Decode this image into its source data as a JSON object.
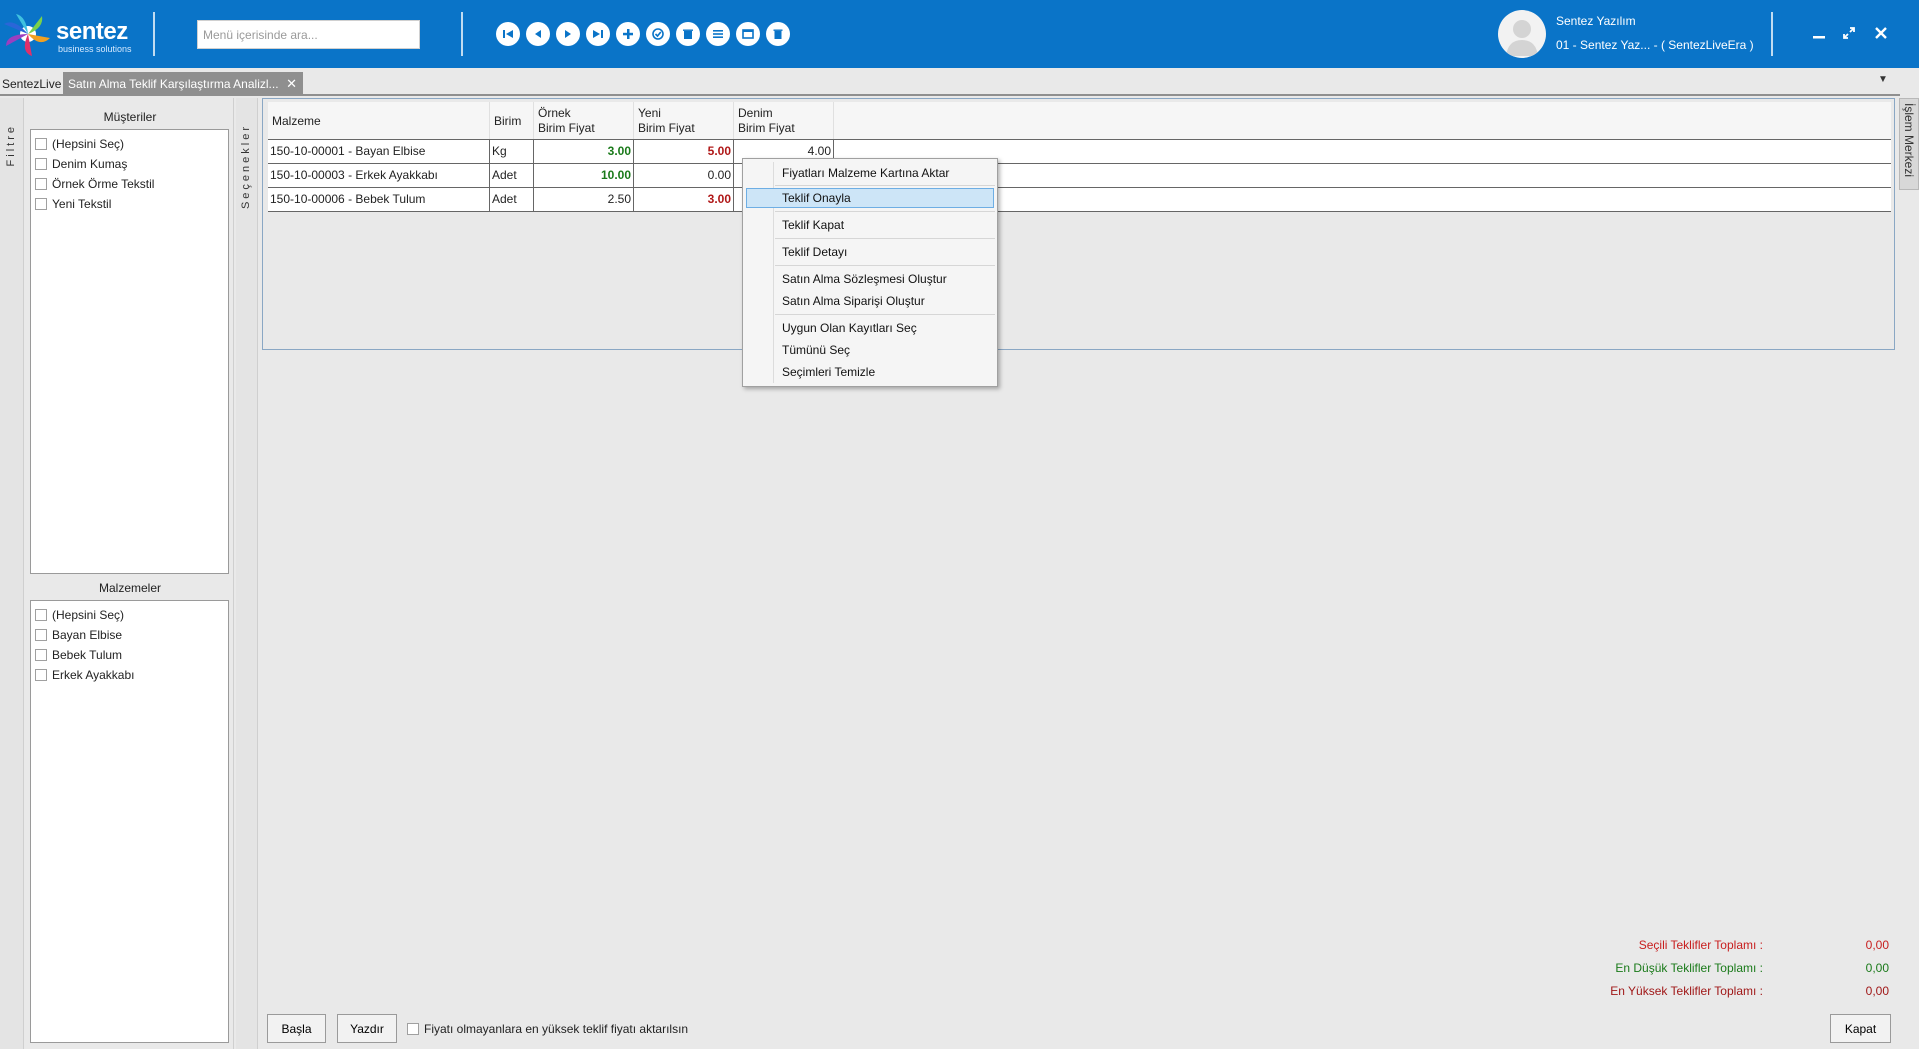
{
  "header": {
    "brand": "sentez",
    "brand_sub": "business solutions",
    "search_placeholder": "Menü içerisinde ara...",
    "user_name": "Sentez Yazılım",
    "company": "01 - Sentez Yaz... - ( SentezLiveEra )",
    "toolbar_icons": [
      "first-icon",
      "previous-icon",
      "next-icon",
      "last-icon",
      "add-icon",
      "approve-icon",
      "delete-icon",
      "list-icon",
      "window-icon",
      "trash-icon"
    ],
    "accent_color": "#0a74c8"
  },
  "tabs": {
    "home": "SentezLive",
    "active": "Satın Alma Teklif Karşılaştırma Analizl...",
    "close": "✕"
  },
  "left": {
    "filter_label": "Filtre",
    "options_label": "Seçenekler",
    "customers_title": "Müşteriler",
    "customers": [
      "(Hepsini Seç)",
      "Denim Kumaş",
      "Örnek Örme Tekstil",
      "Yeni Tekstil"
    ],
    "materials_title": "Malzemeler",
    "materials": [
      "(Hepsini Seç)",
      "Bayan Elbise",
      "Bebek Tulum",
      "Erkek Ayakkabı"
    ]
  },
  "grid": {
    "columns": [
      "Malzeme",
      "Birim",
      "Örnek\nBirim Fiyat",
      "Yeni\nBirim Fiyat",
      "Denim\nBirim Fiyat"
    ],
    "rows": [
      {
        "malzeme": "150-10-00001 - Bayan Elbise",
        "birim": "Kg",
        "ornek": "3.00",
        "yeni": "5.00",
        "denim": "4.00"
      },
      {
        "malzeme": "150-10-00003 - Erkek Ayakkabı",
        "birim": "Adet",
        "ornek": "10.00",
        "yeni": "0.00",
        "denim": ""
      },
      {
        "malzeme": "150-10-00006 - Bebek Tulum",
        "birim": "Adet",
        "ornek": "2.50",
        "yeni": "3.00",
        "denim": ""
      }
    ]
  },
  "context_menu": {
    "items": [
      "Fiyatları Malzeme Kartına Aktar",
      "Teklif Onayla",
      "Teklif Kapat",
      "Teklif Detayı",
      "Satın Alma Sözleşmesi Oluştur",
      "Satın Alma Siparişi Oluştur",
      "Uygun Olan Kayıtları Seç",
      "Tümünü Seç",
      "Seçimleri Temizle"
    ],
    "highlighted": "Teklif Onayla"
  },
  "side_tab": "İşlem Merkezi",
  "totals": {
    "selected_label": "Seçili Teklifler Toplamı :",
    "selected_value": "0,00",
    "lowest_label": "En Düşük Teklifler Toplamı :",
    "lowest_value": "0,00",
    "highest_label": "En Yüksek Teklifler Toplamı :",
    "highest_value": "0,00",
    "colors": {
      "selected": "#c81e1e",
      "lowest": "#1a7a1a",
      "highest": "#a01818"
    }
  },
  "bottom": {
    "start_button": "Başla",
    "print_button": "Yazdır",
    "checkbox_label": "Fiyatı olmayanlara en yüksek teklif fiyatı aktarılsın",
    "close_button": "Kapat"
  }
}
